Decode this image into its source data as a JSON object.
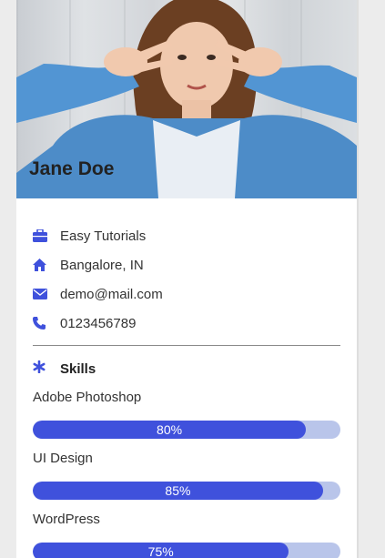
{
  "profile": {
    "name": "Jane Doe"
  },
  "info": [
    {
      "icon": "briefcase-icon",
      "text": "Easy Tutorials"
    },
    {
      "icon": "home-icon",
      "text": "Bangalore, IN"
    },
    {
      "icon": "envelope-icon",
      "text": "demo@mail.com"
    },
    {
      "icon": "phone-icon",
      "text": "0123456789"
    }
  ],
  "skills_section": {
    "icon": "asterisk-icon",
    "title": "Skills",
    "items": [
      {
        "name": "Adobe Photoshop",
        "percent": 80,
        "label": "80%"
      },
      {
        "name": "UI Design",
        "percent": 85,
        "label": "85%"
      },
      {
        "name": "WordPress",
        "percent": 75,
        "label": "75%"
      }
    ]
  },
  "colors": {
    "accent": "#3f51dc",
    "track": "#b9c5ea"
  }
}
